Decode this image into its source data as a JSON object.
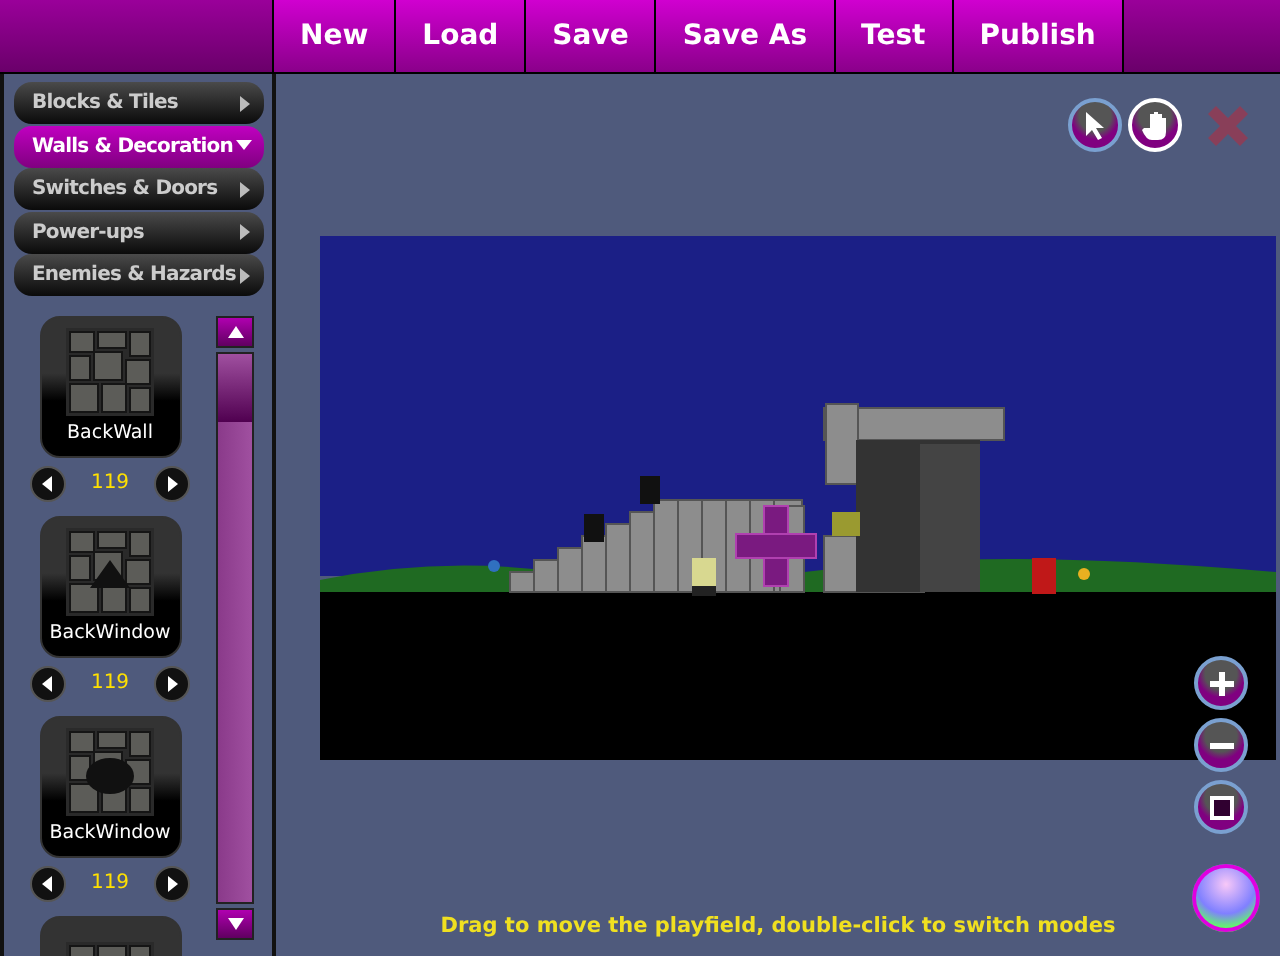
{
  "menu": [
    {
      "label": "New"
    },
    {
      "label": "Load"
    },
    {
      "label": "Save"
    },
    {
      "label": "Save As"
    },
    {
      "label": "Test"
    },
    {
      "label": "Publish"
    }
  ],
  "categories": [
    {
      "label": "Blocks & Tiles",
      "expanded": false
    },
    {
      "label": "Walls & Decoration",
      "expanded": true
    },
    {
      "label": "Switches & Doors",
      "expanded": false
    },
    {
      "label": "Power-ups",
      "expanded": false
    },
    {
      "label": "Enemies & Hazards",
      "expanded": false
    }
  ],
  "tiles": [
    {
      "name": "BackWall",
      "count": "119",
      "kind": "wall"
    },
    {
      "name": "BackWindow",
      "count": "119",
      "kind": "window"
    },
    {
      "name": "BackWindow",
      "count": "119",
      "kind": "arch"
    },
    {
      "kind": "partial"
    }
  ],
  "modes": [
    {
      "kind": "pointer",
      "selected": false
    },
    {
      "kind": "hand",
      "selected": true
    }
  ],
  "close_button": {
    "disabled": true
  },
  "zoom_tools": [
    {
      "kind": "plus"
    },
    {
      "kind": "minus"
    },
    {
      "kind": "fit"
    }
  ],
  "status": "Drag to move the playfield, double-click to switch modes"
}
